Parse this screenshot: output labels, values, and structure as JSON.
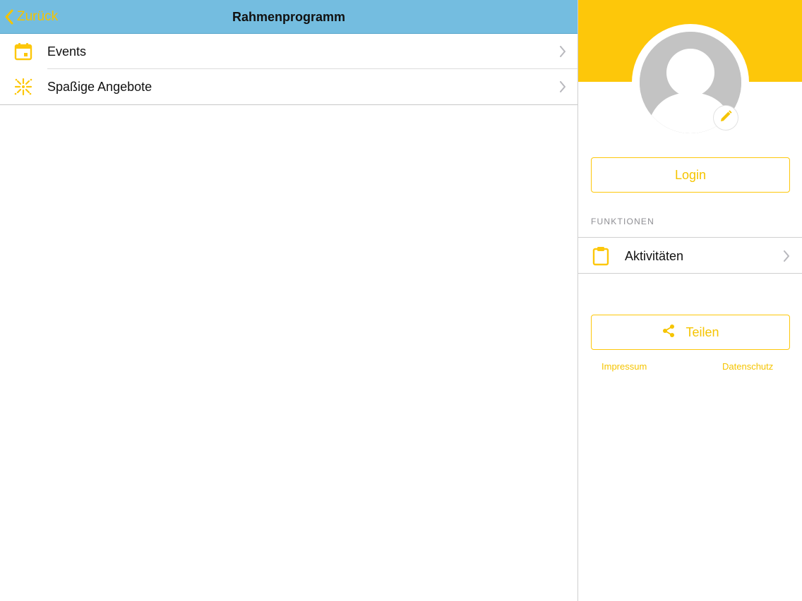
{
  "navbar": {
    "back_label": "Zurück",
    "title": "Rahmenprogramm"
  },
  "menu": {
    "items": [
      {
        "label": "Events",
        "icon": "calendar-icon"
      },
      {
        "label": "Spaßige Angebote",
        "icon": "fireworks-icon"
      }
    ]
  },
  "profile": {
    "avatar": "user-avatar-placeholder",
    "edit_icon": "pencil-icon"
  },
  "sidebar": {
    "login_label": "Login",
    "section_title": "FUNKTIONEN",
    "functions": [
      {
        "label": "Aktivitäten",
        "icon": "clipboard-icon"
      }
    ],
    "share_label": "Teilen",
    "share_icon": "share-icon",
    "links": {
      "impressum": "Impressum",
      "datenschutz": "Datenschutz"
    }
  },
  "colors": {
    "navbar_bg": "#74bde0",
    "accent_yellow": "#fdc70a",
    "link_yellow": "#f5c400",
    "avatar_gray": "#c3c3c3",
    "text": "#111111",
    "section_gray": "#8e8e93"
  }
}
